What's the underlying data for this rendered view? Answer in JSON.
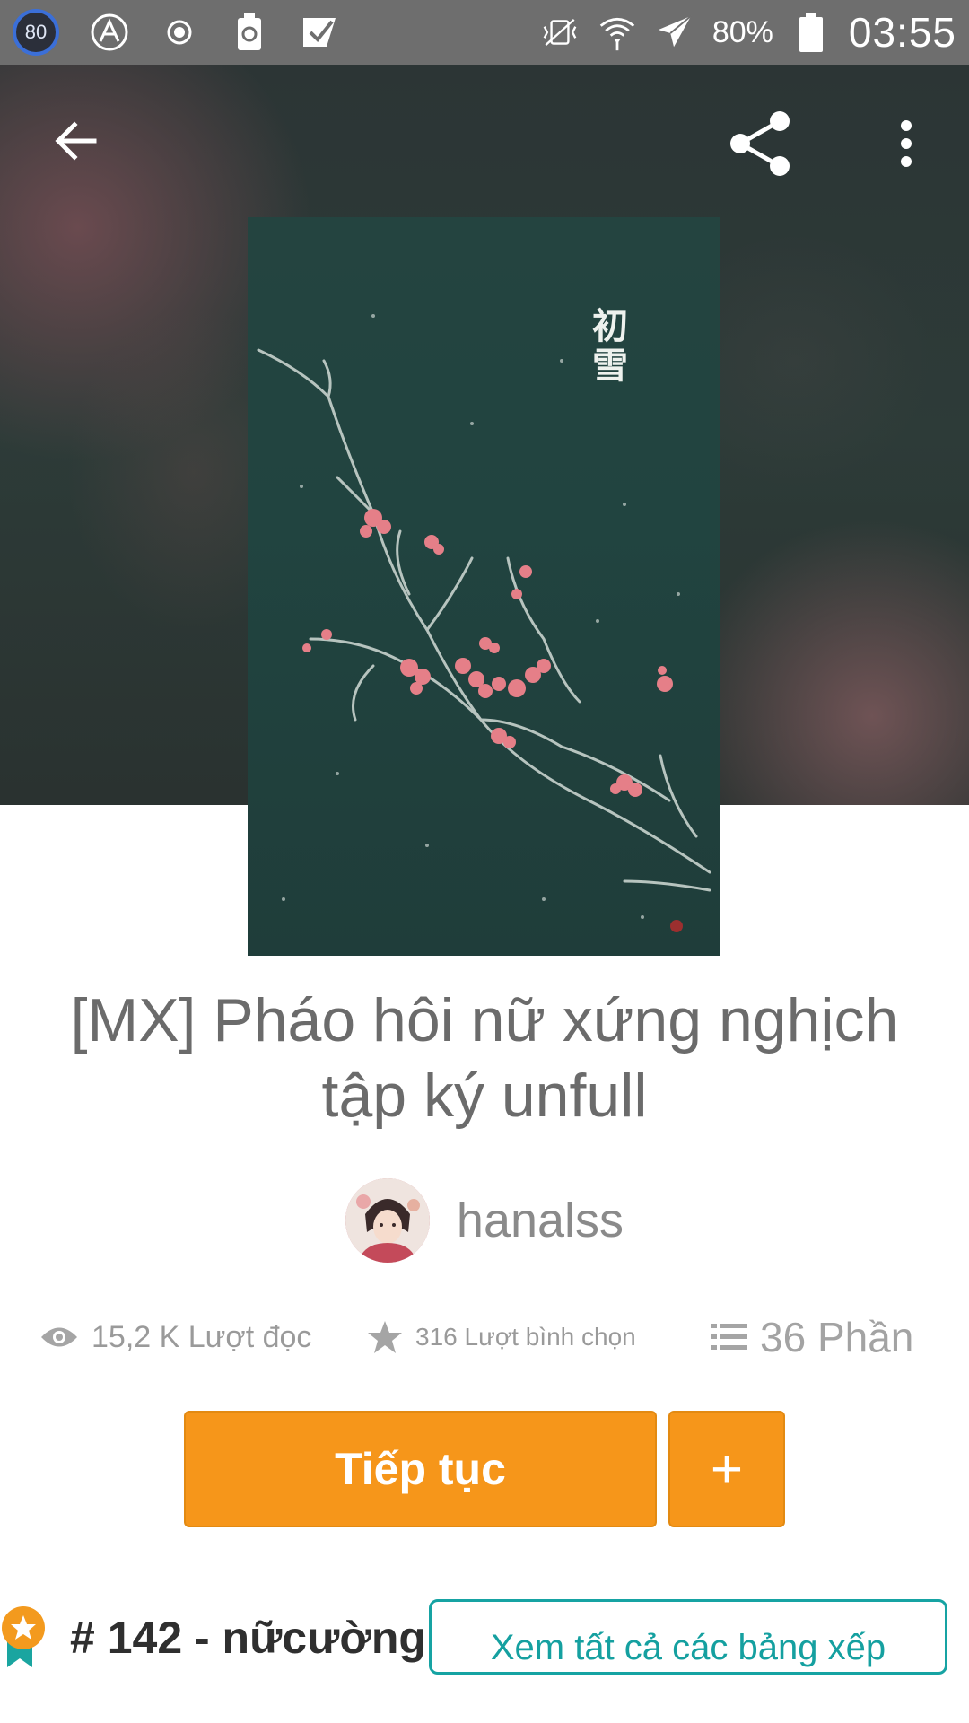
{
  "status_bar": {
    "notification_badge": "80",
    "battery_percent": "80%",
    "time": "03:55"
  },
  "cover": {
    "title_text": "初雪"
  },
  "story": {
    "title": "[MX] Pháo hôi nữ xứng nghịch tập ký unfull",
    "author": "hanalss"
  },
  "stats": {
    "reads": "15,2 K Lượt đọc",
    "votes": "316 Lượt bình chọn",
    "parts": "36 Phần"
  },
  "actions": {
    "continue_label": "Tiếp tục",
    "add_label": "+"
  },
  "ranking": {
    "text": "# 142 - nữcường",
    "view_all_label": "Xem tất cả các bảng xếp"
  },
  "colors": {
    "accent": "#f6961a",
    "teal": "#16a3a3"
  }
}
